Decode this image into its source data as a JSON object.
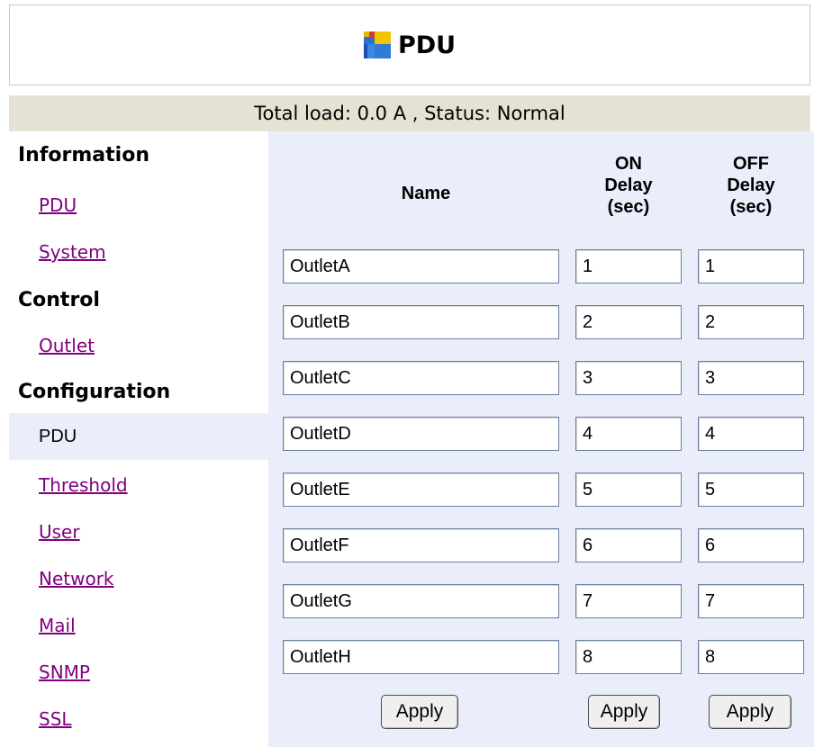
{
  "header": {
    "title": "PDU",
    "logo_icon": "pdu-app-icon"
  },
  "status": {
    "text": "Total load: 0.0 A , Status: Normal"
  },
  "nav": {
    "information_label": "Information",
    "info_pdu": "PDU",
    "info_system": "System",
    "control_label": "Control",
    "control_outlet": "Outlet",
    "configuration_label": "Configuration",
    "config_pdu": "PDU",
    "config_threshold": "Threshold",
    "config_user": "User",
    "config_network": "Network",
    "config_mail": "Mail",
    "config_snmp": "SNMP",
    "config_ssl": "SSL"
  },
  "table": {
    "col_name": "Name",
    "col_on": [
      "ON",
      "Delay",
      "(sec)"
    ],
    "col_off": [
      "OFF",
      "Delay",
      "(sec)"
    ],
    "rows": [
      {
        "name": "OutletA",
        "on": "1",
        "off": "1"
      },
      {
        "name": "OutletB",
        "on": "2",
        "off": "2"
      },
      {
        "name": "OutletC",
        "on": "3",
        "off": "3"
      },
      {
        "name": "OutletD",
        "on": "4",
        "off": "4"
      },
      {
        "name": "OutletE",
        "on": "5",
        "off": "5"
      },
      {
        "name": "OutletF",
        "on": "6",
        "off": "6"
      },
      {
        "name": "OutletG",
        "on": "7",
        "off": "7"
      },
      {
        "name": "OutletH",
        "on": "8",
        "off": "8"
      }
    ],
    "apply_label": "Apply"
  },
  "colors": {
    "panel_bg": "#e9eefa",
    "status_bg": "#e6e2d3",
    "link": "#800080"
  }
}
